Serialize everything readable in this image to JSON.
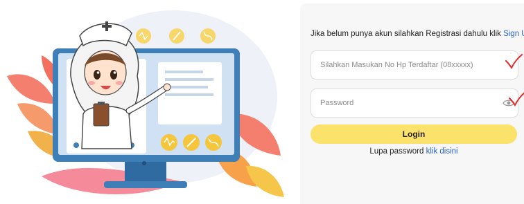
{
  "signup": {
    "prompt": "Jika belum punya akun silahkan Registrasi dahulu klik",
    "link": "Sign Up"
  },
  "phone_field": {
    "placeholder": "Silahkan Masukan No Hp Terdaftar (08xxxxx)"
  },
  "password_field": {
    "placeholder": "Password"
  },
  "login_button": {
    "label": "Login"
  },
  "forgot": {
    "prompt": "Lupa password",
    "link": "klik disini"
  },
  "colors": {
    "accent_yellow": "#fbe26a",
    "link_blue": "#2a63c9",
    "monitor_blue": "#3f7fb8",
    "check_red": "#e52b2b"
  }
}
